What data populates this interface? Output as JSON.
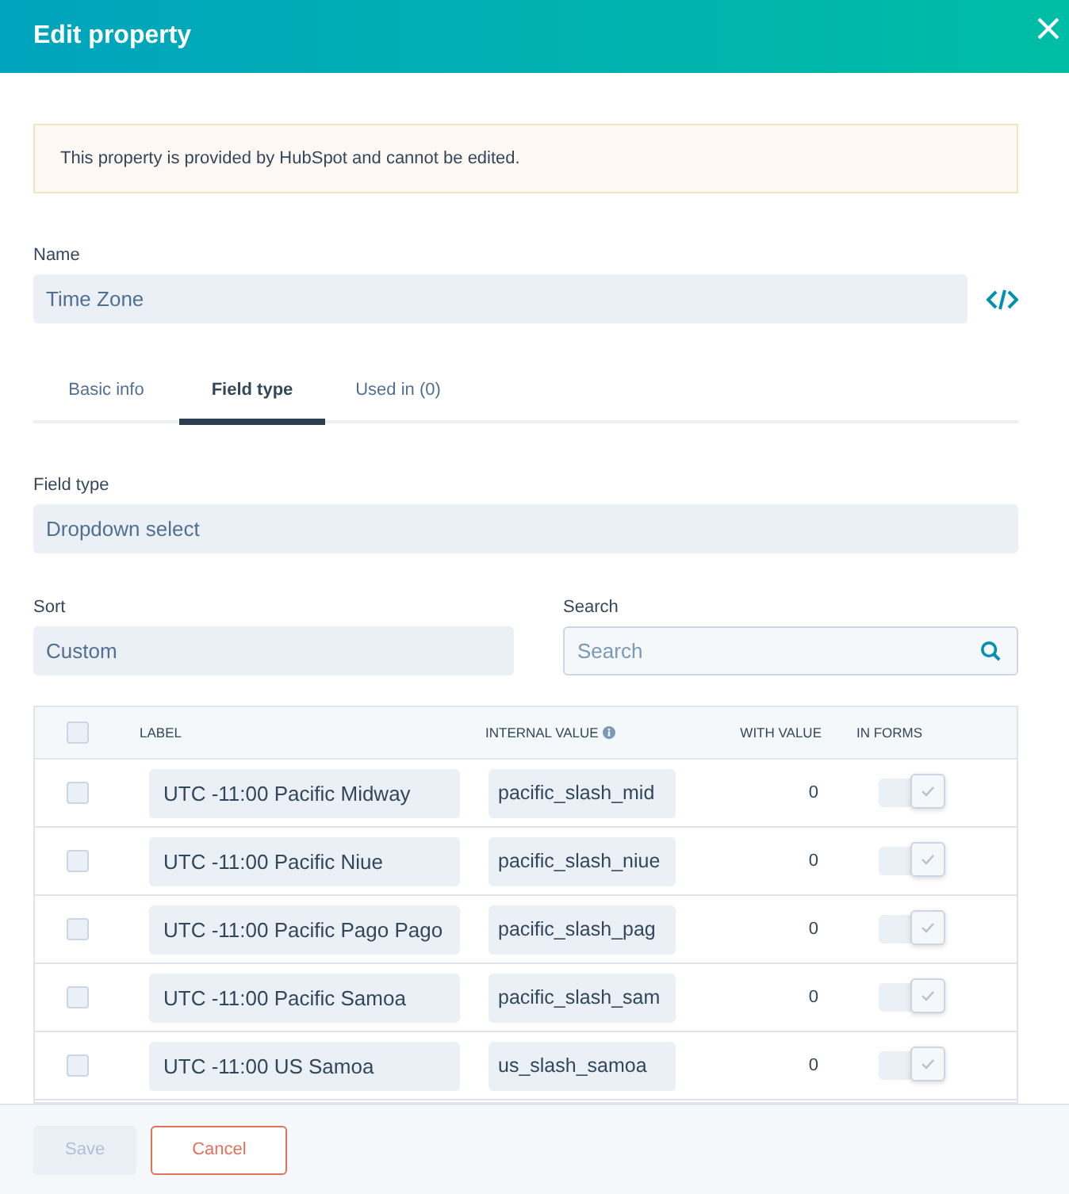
{
  "window": {
    "title": "Edit property"
  },
  "notice": "This property is provided by HubSpot and cannot be edited.",
  "name_field": {
    "label": "Name",
    "value": "Time Zone"
  },
  "tabs": [
    {
      "label": "Basic info",
      "selected": false
    },
    {
      "label": "Field type",
      "selected": true
    },
    {
      "label": "Used in (0)",
      "selected": false
    }
  ],
  "field_type": {
    "label": "Field type",
    "value": "Dropdown select"
  },
  "sort": {
    "label": "Sort",
    "value": "Custom"
  },
  "search": {
    "label": "Search",
    "placeholder": "Search"
  },
  "table": {
    "columns": [
      "LABEL",
      "INTERNAL VALUE",
      "WITH VALUE",
      "IN FORMS"
    ],
    "select_all_checked": false,
    "rows": [
      {
        "checked": false,
        "label": "UTC -11:00 Pacific Midway",
        "internal_value": "pacific_slash_mid",
        "with_value": "0",
        "in_forms": true
      },
      {
        "checked": false,
        "label": "UTC -11:00 Pacific Niue",
        "internal_value": "pacific_slash_niue",
        "with_value": "0",
        "in_forms": true
      },
      {
        "checked": false,
        "label": "UTC -11:00 Pacific Pago Pago",
        "internal_value": "pacific_slash_pag",
        "with_value": "0",
        "in_forms": true
      },
      {
        "checked": false,
        "label": "UTC -11:00 Pacific Samoa",
        "internal_value": "pacific_slash_sam",
        "with_value": "0",
        "in_forms": true
      },
      {
        "checked": false,
        "label": "UTC -11:00 US Samoa",
        "internal_value": "us_slash_samoa",
        "with_value": "0",
        "in_forms": true
      }
    ]
  },
  "buttons": [
    {
      "label": "Save",
      "kind": "primary",
      "disabled": true
    },
    {
      "label": "Cancel",
      "kind": "secondary",
      "disabled": false
    }
  ]
}
